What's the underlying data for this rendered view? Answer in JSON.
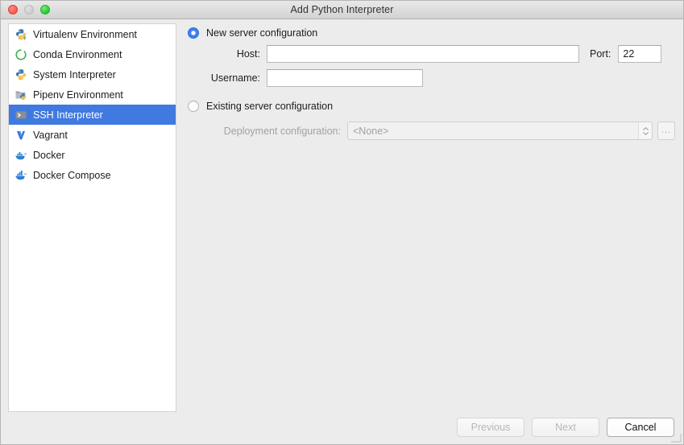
{
  "window": {
    "title": "Add Python Interpreter",
    "traffic_lights": [
      "close-button",
      "minimize-button",
      "maximize-button"
    ],
    "accent_color": "#4079e0",
    "selection_text_color": "#ffffff",
    "background_color": "#ececec"
  },
  "sidebar": {
    "items": [
      {
        "label": "Virtualenv Environment",
        "icon": "python-virtualenv-icon",
        "selected": false
      },
      {
        "label": "Conda Environment",
        "icon": "conda-icon",
        "selected": false
      },
      {
        "label": "System Interpreter",
        "icon": "python-icon",
        "selected": false
      },
      {
        "label": "Pipenv Environment",
        "icon": "pipenv-folder-icon",
        "selected": false
      },
      {
        "label": "SSH Interpreter",
        "icon": "ssh-terminal-icon",
        "selected": true
      },
      {
        "label": "Vagrant",
        "icon": "vagrant-icon",
        "selected": false
      },
      {
        "label": "Docker",
        "icon": "docker-icon",
        "selected": false
      },
      {
        "label": "Docker Compose",
        "icon": "docker-compose-icon",
        "selected": false
      }
    ]
  },
  "main": {
    "new_server": {
      "radio_label": "New server configuration",
      "selected": true,
      "host": {
        "label": "Host:",
        "value": "",
        "placeholder": ""
      },
      "port": {
        "label": "Port:",
        "value": "22"
      },
      "username": {
        "label": "Username:",
        "value": "",
        "placeholder": ""
      }
    },
    "existing_server": {
      "radio_label": "Existing server configuration",
      "selected": false,
      "deployment": {
        "label": "Deployment configuration:",
        "value": "<None>",
        "browse_label": "...",
        "disabled": true
      }
    }
  },
  "footer": {
    "buttons": [
      {
        "label": "Previous",
        "state": "disabled"
      },
      {
        "label": "Next",
        "state": "disabled"
      },
      {
        "label": "Cancel",
        "state": "default"
      }
    ]
  }
}
